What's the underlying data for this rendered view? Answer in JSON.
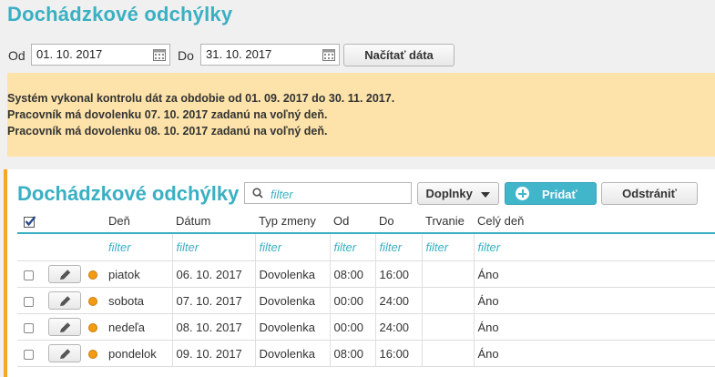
{
  "page": {
    "title": "Dochádzkové odchýlky"
  },
  "filter": {
    "from_label": "Od",
    "from_value": "01. 10. 2017",
    "to_label": "Do",
    "to_value": "31. 10. 2017",
    "load_button": "Načítať dáta",
    "calendar_icon": "calendar-icon"
  },
  "alert": {
    "background": "#fde3a9",
    "lines": [
      "Systém vykonal kontrolu dát za obdobie od 01. 09. 2017 do 30. 11. 2017.",
      "Pracovník má dovolenku 07. 10. 2017 zadanú na voľný deň.",
      "Pracovník má dovolenku 08. 10. 2017 zadanú na voľný deň."
    ]
  },
  "panel": {
    "title": "Dochádzkové odchýlky",
    "accent": "#f5a623",
    "search_placeholder": "filter",
    "addons_button": "Doplnky",
    "add_button": "Pridať",
    "remove_button": "Odstrániť",
    "brand_color": "#3ab0c3"
  },
  "table": {
    "columns": [
      "Deň",
      "Dátum",
      "Typ zmeny",
      "Od",
      "Do",
      "Trvanie",
      "Celý deň"
    ],
    "filter_text": "filter",
    "rows": [
      {
        "day": "piatok",
        "date": "06. 10. 2017",
        "type": "Dovolenka",
        "from": "08:00",
        "to": "16:00",
        "duration": "",
        "full_day": "Áno"
      },
      {
        "day": "sobota",
        "date": "07. 10. 2017",
        "type": "Dovolenka",
        "from": "00:00",
        "to": "24:00",
        "duration": "",
        "full_day": "Áno"
      },
      {
        "day": "nedeľa",
        "date": "08. 10. 2017",
        "type": "Dovolenka",
        "from": "00:00",
        "to": "24:00",
        "duration": "",
        "full_day": "Áno"
      },
      {
        "day": "pondelok",
        "date": "09. 10. 2017",
        "type": "Dovolenka",
        "from": "08:00",
        "to": "16:00",
        "duration": "",
        "full_day": "Áno"
      }
    ],
    "status_color": "#f39c12"
  }
}
